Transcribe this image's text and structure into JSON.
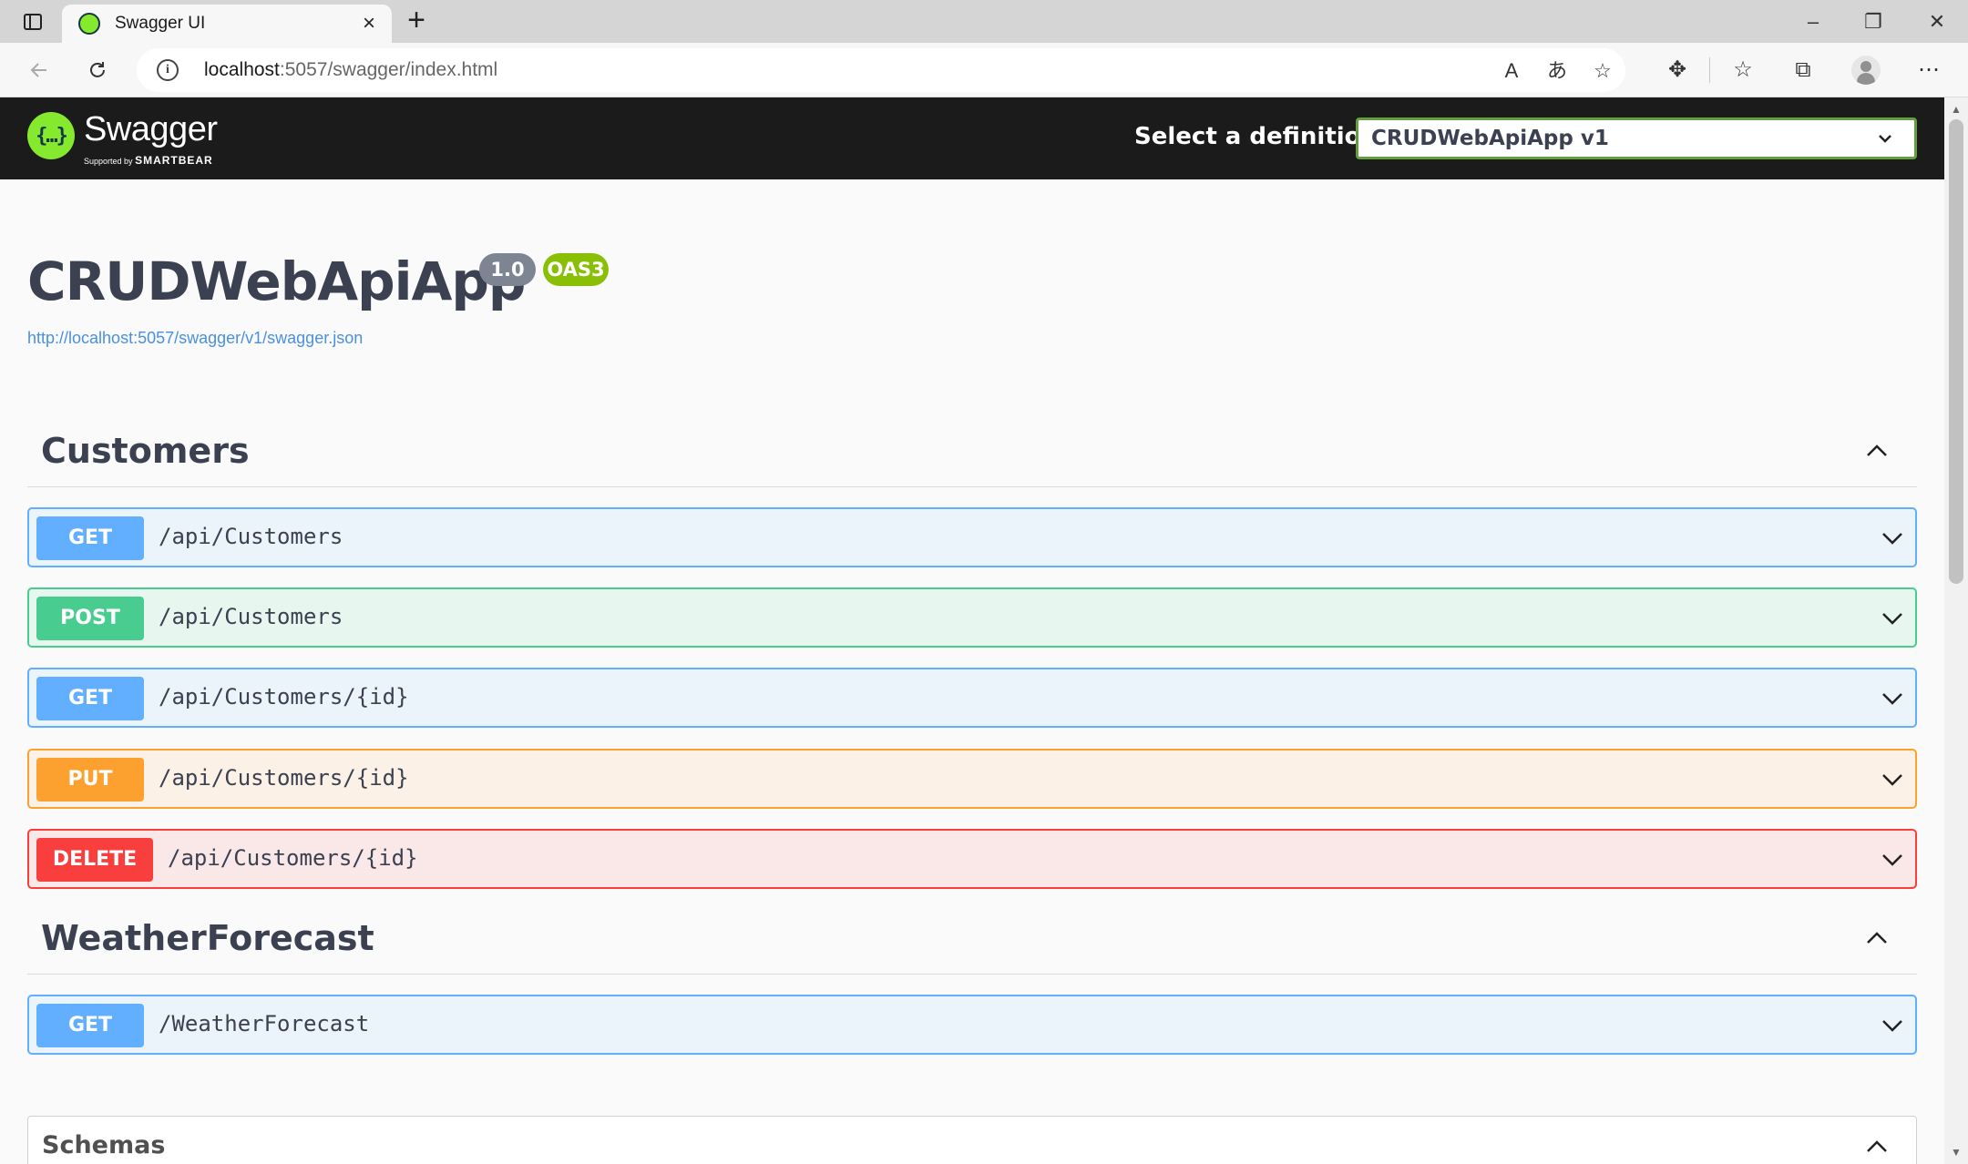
{
  "browser": {
    "tab_title": "Swagger UI",
    "url_host": "localhost",
    "url_rest": ":5057/swagger/index.html"
  },
  "swagger": {
    "logo_text": "Swagger",
    "logo_tagline_prefix": "Supported by",
    "logo_tagline_brand": "SMARTBEAR",
    "definition_label": "Select a definition",
    "definition_value": "CRUDWebApiApp v1"
  },
  "info": {
    "title": "CRUDWebApiApp",
    "version": "1.0",
    "oas": "OAS3",
    "spec_url": "http://localhost:5057/swagger/v1/swagger.json"
  },
  "tags": [
    {
      "name": "Customers",
      "operations": [
        {
          "method": "GET",
          "path": "/api/Customers"
        },
        {
          "method": "POST",
          "path": "/api/Customers"
        },
        {
          "method": "GET",
          "path": "/api/Customers/{id}"
        },
        {
          "method": "PUT",
          "path": "/api/Customers/{id}"
        },
        {
          "method": "DELETE",
          "path": "/api/Customers/{id}"
        }
      ]
    },
    {
      "name": "WeatherForecast",
      "operations": [
        {
          "method": "GET",
          "path": "/WeatherForecast"
        }
      ]
    }
  ],
  "schemas": {
    "title": "Schemas"
  },
  "colors": {
    "get": "#61affe",
    "post": "#49cc90",
    "put": "#fca130",
    "delete": "#f93e3e",
    "swagger_green": "#85ea2d",
    "topbar": "#1b1b1b"
  }
}
